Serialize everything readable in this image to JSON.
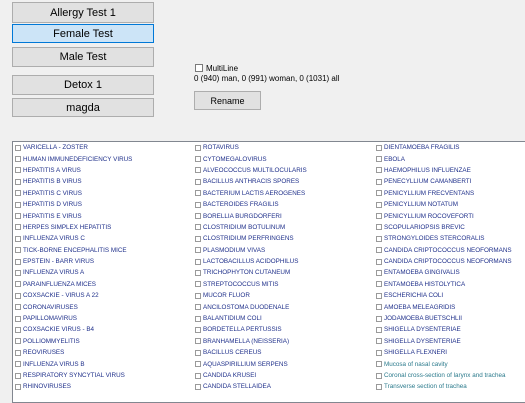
{
  "buttons": {
    "allergy": "Allergy Test 1",
    "female": "Female Test",
    "male": "Male Test",
    "detox": "Detox 1",
    "magda": "magda",
    "rename": "Rename"
  },
  "multiline": {
    "label": "MultiLine",
    "checked": false
  },
  "summary": "0 (940) man, 0 (991) woman, 0 (1031) all",
  "list": {
    "col1": [
      "VARICELLA - ZOSTER",
      "HUMAN IMMUNEDEFICIENCY VIRUS",
      "HEPATITIS A VIRUS",
      "HEPATITIS B VIRUS",
      "HEPATITIS C VIRUS",
      "HEPATITIS D VIRUS",
      "HEPATITIS E VIRUS",
      "HERPES SIMPLEX HEPATITIS",
      "INFLUENZA VIRUS C",
      "TICK-BORNE ENCEPHALITIS MICE",
      "EPSTEIN - BARR VIRUS",
      "INFLUENZA VIRUS A",
      "PARAINFLUENZA MICES",
      "COXSACKIE - VIRUS A 22",
      "CORONAVIRUSES",
      "PAPILLOMAVIRUS",
      "COXSACKIE VIRUS - B4",
      "POLLIOMMYELITIS",
      "REOVIRUSES",
      "INFLUENZA VIRUS B",
      "RESPIRATORY SYNCYTIAL VIRUS",
      "RHINOVIRUSES"
    ],
    "col2": [
      "ROTAVIRUS",
      "CYTOMEGALOVIRUS",
      "ALVEOCOCCUS MULTILOCULARIS",
      "BACILLUS ANTHRACIS SPORES",
      "BACTERIUM LACTIS AEROGENES",
      "BACTEROIDES FRAGILIS",
      "BORELLIA BURGDORFERI",
      "CLOSTRIDIUM BOTULINUM",
      "CLOSTRIDIUM PERFRINGENS",
      "PLASMODIUM VIVAS",
      "LACTOBACILLUS ACIDOPHILUS",
      "TRICHOPHYTON CUTANEUM",
      "STREPTOCOCCUS MITIS",
      "MUCOR FLUOR",
      "ANCILOSTOMA DUODENALE",
      "BALANTIDIUM COLI",
      "BORDETELLA PERTUSSIS",
      "BRANHAMELLA (NEISSERIA)",
      "BACILLUS CEREUS",
      "AQUASPIRILLIUM SERPENS",
      "CANDIDA KRUSEI",
      "CANDIDA STELLAIDEA"
    ],
    "col3": [
      "DIENTAMOEBA FRAGILIS",
      "EBOLA",
      "HAEMOPHILUS INFLUENZAE",
      "PENECYLLIUM CAMANBERTI",
      "PENICYLLIUM FRECVENTANS",
      "PENICYLLIUM NOTATUM",
      "PENICYLLIUM ROCOVEFORTI",
      "SCOPULARIOPSIS BREVIC",
      "STRONGYLOIDES STERCORALIS",
      "CANDIDA CRIPTOCOCCUS NEOFORMANS",
      "CANDIDA CRIPTOCOCCUS NEOFORMANS",
      "ENTAMOEBA GINGIVALIS",
      "ENTAMOEBA HISTOLYTICA",
      "ESCHERICHIA COLI",
      "AMOEBA MELEAGRIDIS",
      "JODAMOEBA BUETSCHLII",
      "SHIGELLA DYSENTERIAE",
      "SHIGELLA DYSENTERIAE",
      "SHIGELLA FLEXNERI",
      "Mucosa of nasal cavity",
      "Coronal cross-section of larynx and trachea",
      "Transverse section of trachea"
    ],
    "teal_items": [
      "Mucosa of nasal cavity",
      "Coronal cross-section of larynx and trachea",
      "Transverse section of trachea"
    ]
  }
}
